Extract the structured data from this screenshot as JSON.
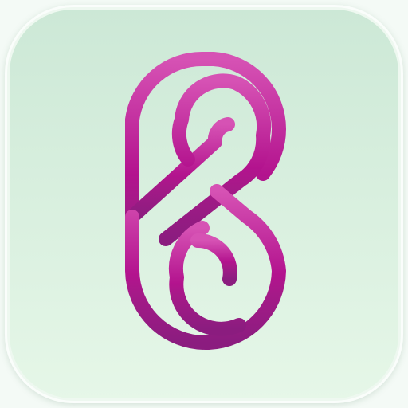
{
  "app_icon": {
    "icon_name": "infinity-knot-logo-icon",
    "colors": {
      "tile_top": "#cce8d6",
      "tile_bottom": "#e6f7e8",
      "logo_top": "#d24fb0",
      "logo_mid": "#b0178c",
      "logo_bottom": "#8a1a7e"
    }
  }
}
